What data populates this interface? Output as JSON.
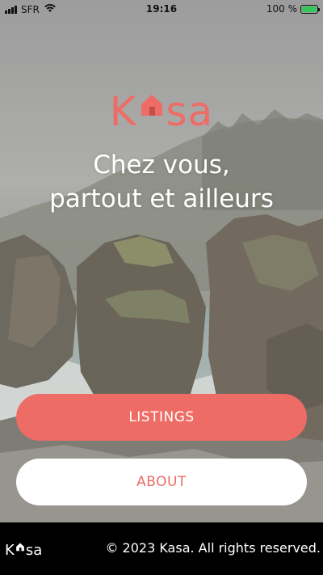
{
  "status_bar": {
    "carrier": "SFR",
    "time": "19:16",
    "battery_percent": "100 %",
    "battery_level": 1.0,
    "icons": [
      "signal-icon",
      "wifi-icon",
      "battery-icon"
    ]
  },
  "hero": {
    "logo_part1": "K",
    "logo_part2": "sa",
    "logo_icon": "house-icon",
    "tagline_line1": "Chez vous,",
    "tagline_line2": "partout et ailleurs"
  },
  "actions": {
    "listings_label": "LISTINGS",
    "about_label": "ABOUT"
  },
  "footer": {
    "logo_part1": "K",
    "logo_part2": "sa",
    "copyright": "© 2023 Kasa. All rights reserved."
  },
  "colors": {
    "brand": "#ee6c66",
    "footer_bg": "#000000",
    "button_secondary_bg": "#ffffff"
  }
}
